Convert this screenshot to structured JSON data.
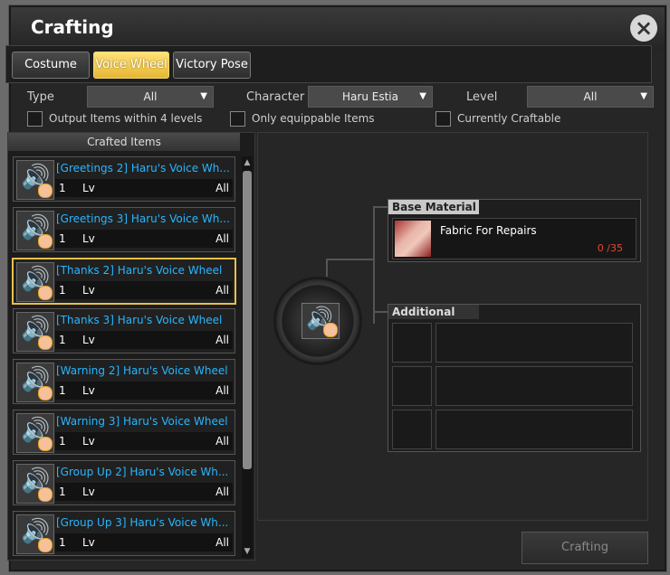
{
  "window": {
    "title": "Crafting",
    "close_icon": "×"
  },
  "tabs": [
    {
      "label": "Costume",
      "active": false
    },
    {
      "label": "Voice Wheel",
      "active": true
    },
    {
      "label": "Victory Pose",
      "active": false
    }
  ],
  "filters": {
    "type": {
      "label": "Type",
      "value": "All"
    },
    "character": {
      "label": "Character",
      "value": "Haru Estia"
    },
    "level": {
      "label": "Level",
      "value": "All"
    }
  },
  "checkboxes": [
    {
      "label": "Output Items within 4 levels",
      "checked": false
    },
    {
      "label": "Only equippable Items",
      "checked": false
    },
    {
      "label": "Currently Craftable",
      "checked": false
    }
  ],
  "crafted_items": {
    "header": "Crafted Items",
    "items": [
      {
        "name": "[Greetings 2] Haru's Voice Wh...",
        "num": "1",
        "lv": "Lv",
        "val": "All"
      },
      {
        "name": "[Greetings 3] Haru's Voice Wh...",
        "num": "1",
        "lv": "Lv",
        "val": "All"
      },
      {
        "name": "[Thanks 2] Haru's Voice Wheel",
        "num": "1",
        "lv": "Lv",
        "val": "All",
        "selected": true
      },
      {
        "name": "[Thanks 3] Haru's Voice Wheel",
        "num": "1",
        "lv": "Lv",
        "val": "All"
      },
      {
        "name": "[Warning 2] Haru's Voice Wheel",
        "num": "1",
        "lv": "Lv",
        "val": "All"
      },
      {
        "name": "[Warning 3] Haru's Voice Wheel",
        "num": "1",
        "lv": "Lv",
        "val": "All"
      },
      {
        "name": "[Group Up 2] Haru's Voice Wh...",
        "num": "1",
        "lv": "Lv",
        "val": "All"
      },
      {
        "name": "[Group Up 3] Haru's Voice Wh...",
        "num": "1",
        "lv": "Lv",
        "val": "All"
      }
    ]
  },
  "base_material": {
    "header": "Base Material",
    "name": "Fabric For Repairs",
    "count": "0 /35"
  },
  "additional": {
    "header": "Additional"
  },
  "craft_button": "Crafting",
  "colors": {
    "accent": "#e8c04a",
    "item_name": "#27b6ff",
    "count_red": "#e5453a"
  }
}
